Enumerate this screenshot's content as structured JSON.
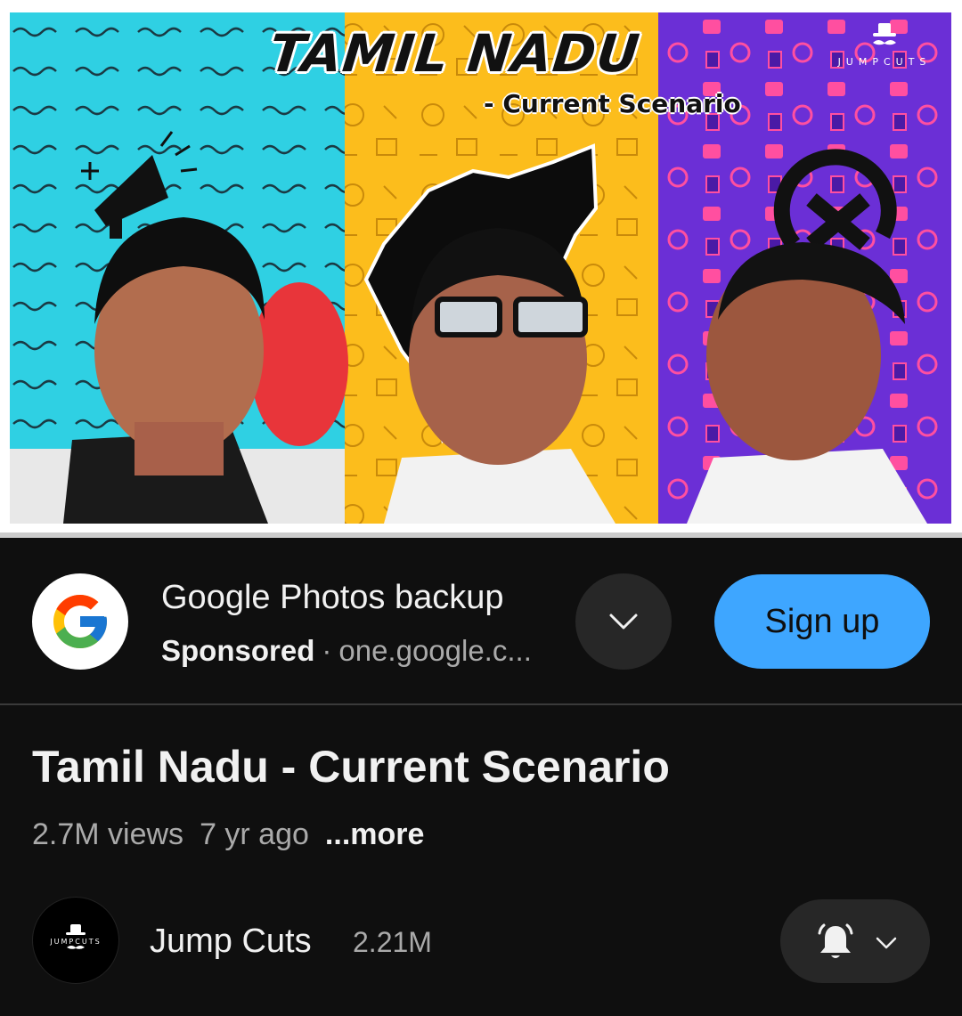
{
  "thumbnail": {
    "title": "TAMIL NADU",
    "subtitle": "- Current Scenario",
    "logo_text": "JUMPCUTS",
    "panel_colors": [
      "#2fd0e3",
      "#fcbd1c",
      "#6b2fd6"
    ]
  },
  "ad": {
    "logo_icon": "google-g-logo-icon",
    "title": "Google Photos backup",
    "sponsored_label": "Sponsored",
    "separator": "·",
    "url": "one.google.c...",
    "expand_icon": "chevron-down-icon",
    "cta_label": "Sign up",
    "cta_color": "#3ea6ff"
  },
  "video": {
    "title": "Tamil Nadu - Current Scenario",
    "views": "2.7M views",
    "age": "7 yr ago",
    "more_label": "...more"
  },
  "channel": {
    "avatar_text": "JUMPCUTS",
    "name": "Jump Cuts",
    "subscribers": "2.21M",
    "bell_icon": "bell-icon",
    "dropdown_icon": "chevron-down-icon"
  }
}
